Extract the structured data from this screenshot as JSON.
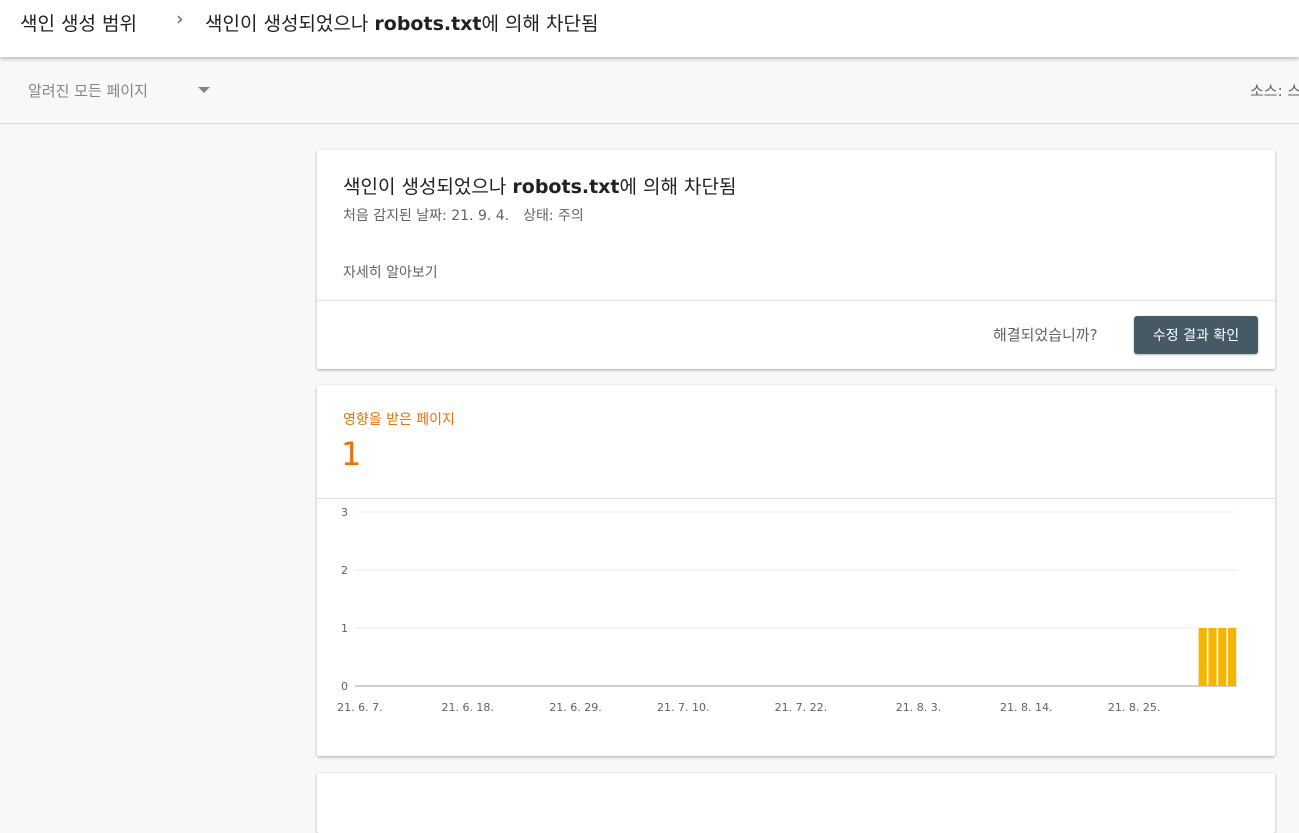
{
  "breadcrumb": {
    "root": "색인 생성 범위",
    "separator": "›",
    "current_prefix": "색인이 생성되었으나 ",
    "current_bold": "robots.txt",
    "current_suffix": "에 의해 차단됨"
  },
  "filter": {
    "selected": "알려진 모든 페이지",
    "source_label": "소스: 스"
  },
  "issue": {
    "title_prefix": "색인이 생성되었으나 ",
    "title_bold": "robots.txt",
    "title_suffix": "에 의해 차단됨",
    "first_detected": "처음 감지된 날짜: 21. 9. 4.",
    "status": "상태: 주의",
    "learn_more": "자세히 알아보기",
    "fixed_question": "해결되었습니까?",
    "validate_button": "수정 결과 확인"
  },
  "affected": {
    "label": "영향을 받은 페이지",
    "count": "1"
  },
  "colors": {
    "accent_orange": "#e8710a",
    "bar_yellow": "#f4b400",
    "button_bg": "#455a64"
  },
  "chart_data": {
    "type": "bar",
    "title": "",
    "xlabel": "",
    "ylabel": "",
    "ylim": [
      0,
      3
    ],
    "yticks": [
      "0",
      "1",
      "2",
      "3"
    ],
    "xticks": [
      "21. 6. 7.",
      "21. 6. 18.",
      "21. 6. 29.",
      "21. 7. 10.",
      "21. 7. 22.",
      "21. 8. 3.",
      "21. 8. 14.",
      "21. 8. 25."
    ],
    "x_start": "2021-06-07",
    "x_end": "2021-09-04",
    "bars": [
      {
        "date": "2021-09-01",
        "value": 1
      },
      {
        "date": "2021-09-02",
        "value": 1
      },
      {
        "date": "2021-09-03",
        "value": 1
      },
      {
        "date": "2021-09-04",
        "value": 1
      }
    ],
    "grid": true
  }
}
